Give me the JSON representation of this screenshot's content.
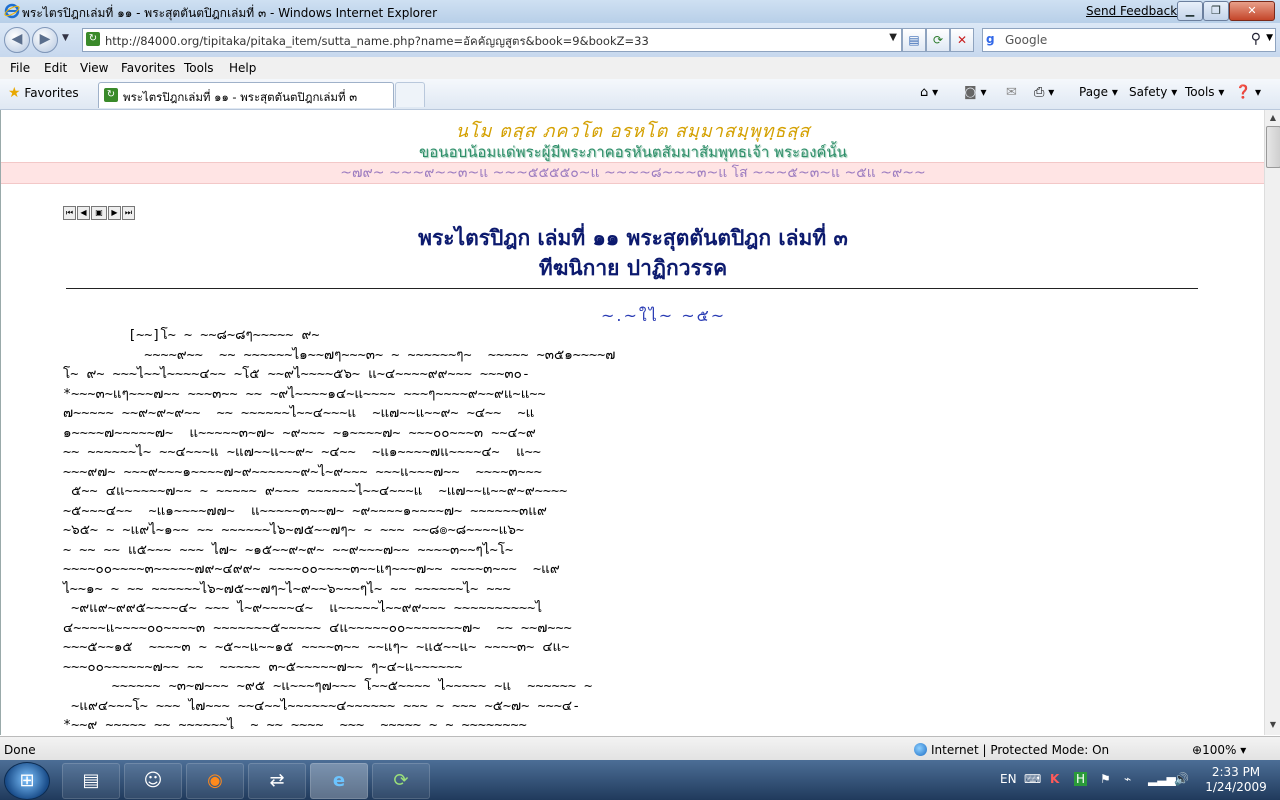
{
  "window": {
    "title": "พระไตรปิฎกเล่มที่ ๑๑ - พระสุตตันตปิฎกเล่มที่ ๓ - Windows Internet Explorer",
    "send_feedback": "Send Feedback"
  },
  "address": {
    "url": "http://84000.org/tipitaka/pitaka_item/sutta_name.php?name=อัคคัญญสูตร&book=9&bookZ=33",
    "search_placeholder": "Google"
  },
  "menu": [
    "File",
    "Edit",
    "View",
    "Favorites",
    "Tools",
    "Help"
  ],
  "favorites": {
    "label": "Favorites",
    "tab_title": "พระไตรปิฎกเล่มที่ ๑๑ - พระสุตตันตปิฎกเล่มที่ ๓"
  },
  "commandbar": {
    "page": "Page",
    "safety": "Safety",
    "tools": "Tools"
  },
  "page": {
    "banner_pali": "นโม ตสฺส ภควโต อรหโต สมฺมาสมฺพุทฺธสฺส",
    "banner_thai": "ขอนอบน้อมแด่พระผู้มีพระภาคอรหันตสัมมาสัมพุทธเจ้า พระองค์นั้น",
    "pink_line": "~๗๙~ ~~~๙~~๓~แ ~~~๕๕๕๕๐~แ ~~~~๘~~~๓~แ โส ~~~๕~๓~แ ~๕แ ~๙~~",
    "heading1": "พระไตรปิฎก เล่มที่ ๑๑  พระสุตตันตปิฎก เล่มที่ ๓",
    "heading2": "ทีฆนิกาย ปาฏิกวรรค",
    "section_title": "~.~ใไ~  ~๕~",
    "paragraph": "        [~~]โ~ ~ ~~๘~๘ๆ~~~~~ ๙~\n          ~~~~๙~~  ~~ ~~~~~~ไ๑~~๗ๆ~~~๓~ ~ ~~~~~~ๆ~  ~~~~~ ~๓๕๑~~~~๗\nโ~ ๙~ ~~~ไ~~ไ~~~~๔~~ ~โ๕ ~~๙ไ~~~~๕๖~ แ~๔~~~~๙๙~~~ ~~~๓๐-\n*~~~๓~แๆ~~~๗~~ ~~~๓~~ ~~ ~๙ไ~~~~๑๔~แ~~~~ ~~~ๆ~~~~๙~~๙แ~แ~~\n๗~~~~~ ~~๙~๙~๙~~  ~~ ~~~~~~ไ~~๔~~~แ  ~แ๗~~แ~~๙~ ~๔~~  ~แ\n๑~~~~๗~~~~~๗~  แ~~~~~๓~๗~ ~๙~~~ ~๑~~~~๗~ ~~~๐๐~~~๓ ~~๔~๙\n~~ ~~~~~~ไ~ ~~๔~~~แ ~แ๗~~แ~~๙~ ~๔~~  ~แ๑~~~~๗แ~~~~๔~  แ~~\n~~~๙๗~ ~~~๙~~~๑~~~~๗~๙~~~~~~๙~ไ~๙~~~ ~~~แ~~~๗~~  ~~~~๓~~~\n ๕~~ ๔แ~~~~~๗~~ ~ ~~~~~ ๙~~~ ~~~~~~ไ~~๔~~~แ  ~แ๗~~แ~~๙~๙~~~~\n~๕~~~๔~~  ~แ๑~~~~๗๗~  แ~~~~~๓~~๗~ ~๙~~~~๑~~~~๗~ ~~~~~~๓แ๙\n~๖๕~ ~ ~แ๙ไ~๑~~ ~~ ~~~~~~ไ๖~๗๕~~๗ๆ~ ~ ~~~ ~~๘๏~๘~~~~แ๖~\n~ ~~ ~~ แ๕~~~ ~~~ ไ๗~ ~๑๕~~๙~๙~ ~~๙~~~๗~~ ~~~~๓~~ๆไ~โ~\n~~~~๐๐~~~~๓~~~~~๗๙~๔๙๙~ ~~~~๐๐~~~~๓~~แๆ~~~๗~~ ~~~~๓~~~  ~แ๙\nไ~~๑~ ~ ~~ ~~~~~~ไ๖~๗๕~~๗ๆ~ไ~๙~~๖~~~ๆไ~ ~~ ~~~~~~ไ~ ~~~\n ~๙แ๙~๙๙๕~~~~๔~ ~~~ ไ~๙~~~~๔~  แ~~~~~ไ~~๙๙~~~ ~~~~~~~~~~ไ\n๔~~~~แ~~~~๐๐~~~~๓ ~~~~~~~๕~~~~~ ๔แ~~~~~๐๐~~~~~~~๗~  ~~ ~~๗~~~\n~~~๕~~๑๕  ~~~~๓ ~ ~๕~~แ~~๑๕ ~~~~๓~~ ~~แๆ~ ~แ๕~~แ~ ~~~~๓~ ๔แ~\n~~~๐๐~~~~~~๗~~ ~~  ~~~~~ ๓~๕~~~~~๗~~ ๆ~๔~แ~~~~~~\n      ~~~~~~ ~๓~๗~~~ ~๙๕ ~แ~~~ๆ๗~~~ โ~~๕~~~~ ไ~~~~~ ~แ  ~~~~~~ ~\n ~แ๙๔~~~โ~ ~~~ ไ๗~~~ ~~๔~~ไ~~~~~~๔~~~~~~ ~~~ ~ ~~~ ~๕~๗~ ~~~๔-\n*~~๙ ~~~~~ ~~ ~~~~~~ไ  ~ ~~ ~~~~  ~~~  ~~~~~ ~ ~ ~~~~~~~~"
  },
  "status": {
    "left": "Done",
    "zone": "Internet | Protected Mode: On",
    "zoom": "100%"
  },
  "tray": {
    "lang": "EN",
    "time": "2:33 PM",
    "date": "1/24/2009"
  }
}
